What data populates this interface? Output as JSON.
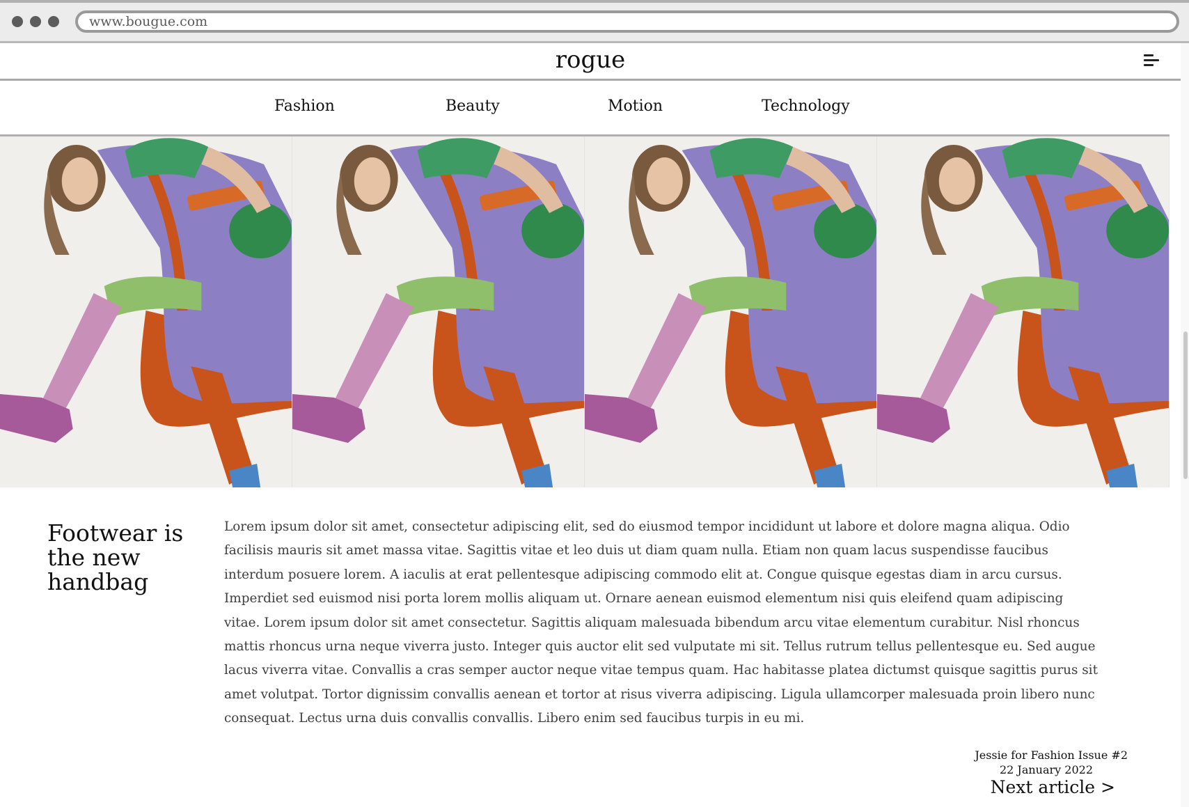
{
  "browser": {
    "url": "www.bougue.com"
  },
  "site": {
    "logo": "rogue"
  },
  "nav": [
    {
      "label": "Fashion"
    },
    {
      "label": "Beauty"
    },
    {
      "label": "Motion"
    },
    {
      "label": "Technology"
    }
  ],
  "hero": {
    "image_description": "fashion-model-repeated",
    "panel_count": 4
  },
  "article": {
    "headline": "Footwear is the new handbag",
    "body": "Lorem ipsum dolor sit amet, consectetur adipiscing elit, sed do eiusmod tempor incididunt ut labore et dolore magna aliqua. Odio facilisis mauris sit amet massa vitae. Sagittis vitae et leo duis ut diam quam nulla. Etiam non quam lacus suspendisse faucibus interdum posuere lorem. A iaculis at erat pellentesque adipiscing commodo elit at. Congue quisque egestas diam in arcu cursus. Imperdiet sed euismod nisi porta lorem mollis aliquam ut. Ornare aenean euismod elementum nisi quis eleifend quam adipiscing vitae. Lorem ipsum dolor sit amet consectetur. Sagittis aliquam malesuada bibendum arcu vitae elementum curabitur. Nisl rhoncus mattis rhoncus urna neque viverra justo. Integer quis auctor elit sed vulputate mi sit. Tellus rutrum tellus pellentesque eu. Sed augue lacus viverra vitae. Convallis a cras semper auctor neque vitae tempus quam. Hac habitasse platea dictumst quisque sagittis purus sit amet volutpat. Tortor dignissim convallis aenean et tortor at risus viverra adipiscing. Ligula ullamcorper malesuada proin libero nunc consequat. Lectus urna duis convallis convallis. Libero enim sed faucibus turpis in eu mi.",
    "credit": "Jessie for Fashion Issue #2",
    "date": "22 January 2022",
    "next_label": "Next article >"
  },
  "colors": {
    "background": "#ffffff",
    "text": "#111111",
    "body_text": "#3e3e3e",
    "divider": "#a8a8a8"
  }
}
